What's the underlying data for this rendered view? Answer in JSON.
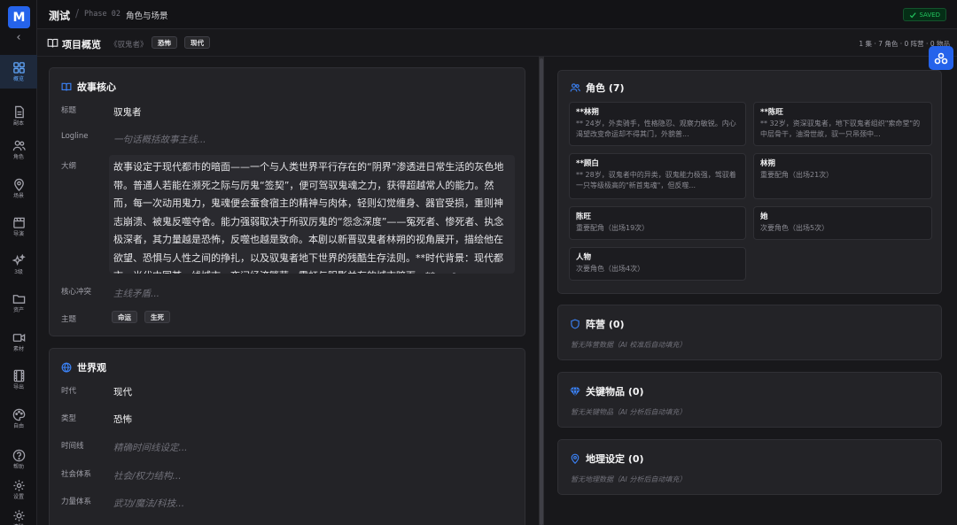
{
  "app": {
    "logo": "M",
    "collapse_icon": "chevron-left-icon"
  },
  "sidebar": {
    "items": [
      {
        "label": "概览",
        "icon": "grid-icon",
        "active": true
      },
      {
        "label": "副本",
        "icon": "document-icon"
      },
      {
        "label": "角色",
        "icon": "users-icon"
      },
      {
        "label": "场景",
        "icon": "map-pin-icon"
      },
      {
        "label": "导演",
        "icon": "clapperboard-icon"
      },
      {
        "label": "3级",
        "icon": "sparkles-icon"
      },
      {
        "label": "资产",
        "icon": "folder-icon"
      },
      {
        "label": "素材",
        "icon": "video-icon"
      },
      {
        "label": "导出",
        "icon": "film-icon"
      },
      {
        "label": "自由",
        "icon": "palette-icon"
      }
    ],
    "bottom_items": [
      {
        "label": "帮助",
        "icon": "help-icon"
      },
      {
        "label": "设置",
        "icon": "gear-icon"
      },
      {
        "label": "清除",
        "icon": "sun-icon"
      }
    ]
  },
  "topbar": {
    "title": "测试",
    "separator": "/",
    "phase": "Phase 02",
    "page": "角色与场景",
    "saved": "SAVED"
  },
  "header": {
    "title": "项目概览",
    "subtitle": "《驭鬼者》",
    "tags": [
      "恐怖",
      "现代"
    ],
    "stats": "1 集 · 7 角色 · 0 阵营 · 0 物品"
  },
  "story_core": {
    "title": "故事核心",
    "fields": {
      "title_label": "标题",
      "title_value": "驭鬼者",
      "logline_label": "Logline",
      "logline_placeholder": "一句话概括故事主线...",
      "synopsis_label": "大纲",
      "synopsis_text": "故事设定于现代都市的暗面——一个与人类世界平行存在的“阴界”渗透进日常生活的灰色地带。普通人若能在濒死之际与厉鬼“签契”，便可驾驭鬼魂之力，获得超越常人的能力。然而，每一次动用鬼力，鬼魂便会蚕食宿主的精神与肉体，轻则幻觉缠身、器官受损，重则神志崩溃、被鬼反噬夺舍。能力强弱取决于所驭厉鬼的“怨念深度”——冤死者、惨死者、执念极深者，其力量越是恐怖，反噬也越是致命。本剧以新晋驭鬼者林朔的视角展开，描绘他在欲望、恐惧与人性之间的挣扎，以及驭鬼者地下世界的残酷生存法则。**时代背景：现代都市，当代中国某一线城市，夜间经济繁荣、霓虹与阴影并存的城市暗面。** ---",
      "conflict_label": "核心冲突",
      "conflict_placeholder": "主线矛盾...",
      "theme_label": "主题",
      "themes": [
        "命运",
        "生死"
      ]
    }
  },
  "world": {
    "title": "世界观",
    "fields": [
      {
        "label": "时代",
        "value": "现代",
        "placeholder": false
      },
      {
        "label": "类型",
        "value": "恐怖",
        "placeholder": false
      },
      {
        "label": "时间线",
        "value": "精确时间线设定...",
        "placeholder": true
      },
      {
        "label": "社会体系",
        "value": "社会/权力结构...",
        "placeholder": true
      },
      {
        "label": "力量体系",
        "value": "武功/魔法/科技...",
        "placeholder": true
      }
    ]
  },
  "characters": {
    "title": "角色 (7)",
    "items": [
      {
        "name": "**林朔",
        "desc": "** 24岁，外卖骑手，性格隐忍、观察力敏锐。内心渴望改变命运却不得其门，外貌普..."
      },
      {
        "name": "**陈旺",
        "desc": "** 32岁，资深驭鬼者，地下驭鬼者组织\"索命堂\"的中层骨干，油滑世故，驭一只吊颈中..."
      },
      {
        "name": "**顾白",
        "desc": "** 28岁，驭鬼者中的异类，驭鬼能力极强，驾驭着一只等级极高的\"新首鬼魂\"，但反噬..."
      },
      {
        "name": "林朔",
        "desc": "重要配角（出场21次）"
      },
      {
        "name": "陈旺",
        "desc": "重要配角（出场19次）"
      },
      {
        "name": "她",
        "desc": "次要角色（出场5次）"
      },
      {
        "name": "人物",
        "desc": "次要角色（出场4次）"
      }
    ]
  },
  "factions": {
    "title": "阵营 (0)",
    "empty": "暂无阵营数据（AI 校准后自动填充）"
  },
  "items": {
    "title": "关键物品 (0)",
    "empty": "暂无关键物品（AI 分析后自动填充）"
  },
  "geography": {
    "title": "地理设定 (0)",
    "empty": "暂无地理数据（AI 分析后自动填充）"
  },
  "colors": {
    "accent": "#2563eb",
    "saved": "#22c55e",
    "background": "#18181b",
    "panel": "#232327"
  }
}
